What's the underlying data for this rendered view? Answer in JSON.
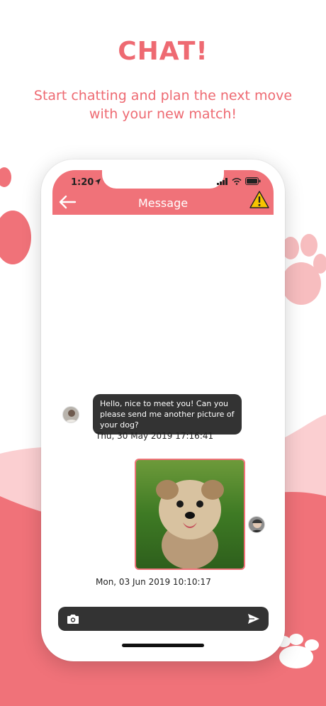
{
  "promo": {
    "headline": "CHAT!",
    "subtitle": "Start chatting and plan the next move with your new match!"
  },
  "status_bar": {
    "time": "1:20",
    "icons": [
      "location-arrow-icon",
      "signal-icon",
      "wifi-icon",
      "battery-icon"
    ]
  },
  "header": {
    "title": "Message",
    "back_icon": "arrow-left-icon",
    "report_icon": "warning-icon"
  },
  "messages": [
    {
      "direction": "incoming",
      "type": "text",
      "text": "Hello, nice to meet you! Can you please send me another picture of your dog?",
      "timestamp": "Thu, 30 May 2019 17:16:41"
    },
    {
      "direction": "outgoing",
      "type": "image",
      "image_subject": "yorkshire terrier puppy on grass",
      "timestamp": "Mon, 03 Jun 2019 10:10:17"
    }
  ],
  "composer": {
    "camera_icon": "camera-icon",
    "send_icon": "send-icon"
  },
  "colors": {
    "brand": "#f07279",
    "bubble": "#333333",
    "text_on_brand": "#ffffff"
  }
}
